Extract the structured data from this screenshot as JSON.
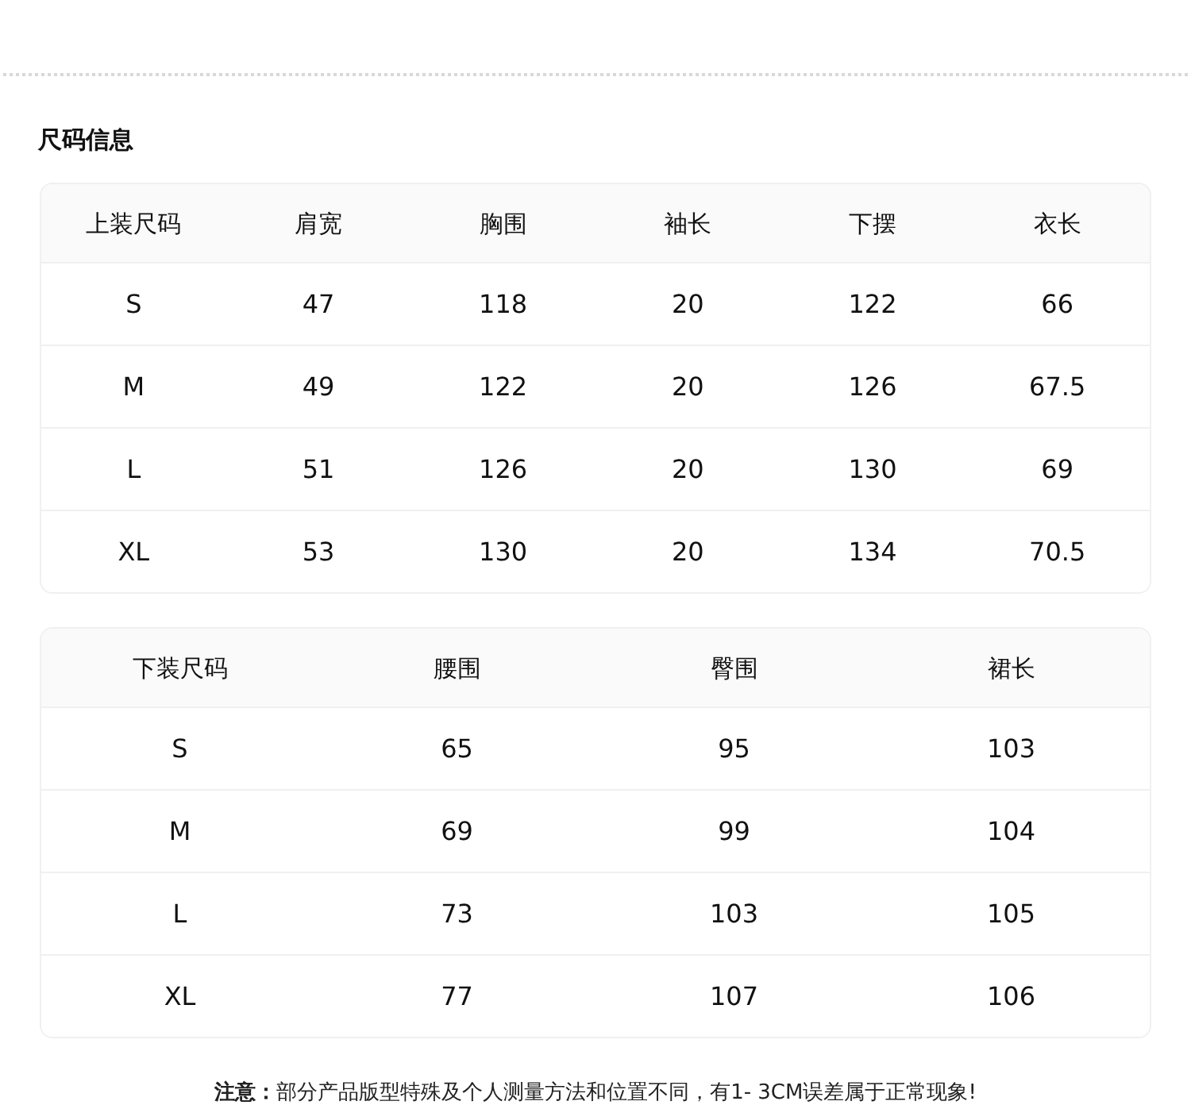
{
  "title": "尺码信息",
  "tables": [
    {
      "columns": [
        "上装尺码",
        "肩宽",
        "胸围",
        "袖长",
        "下摆",
        "衣长"
      ],
      "rows": [
        [
          "S",
          "47",
          "118",
          "20",
          "122",
          "66"
        ],
        [
          "M",
          "49",
          "122",
          "20",
          "126",
          "67.5"
        ],
        [
          "L",
          "51",
          "126",
          "20",
          "130",
          "69"
        ],
        [
          "XL",
          "53",
          "130",
          "20",
          "134",
          "70.5"
        ]
      ]
    },
    {
      "columns": [
        "下装尺码",
        "腰围",
        "臀围",
        "裙长"
      ],
      "rows": [
        [
          "S",
          "65",
          "95",
          "103"
        ],
        [
          "M",
          "69",
          "99",
          "104"
        ],
        [
          "L",
          "73",
          "103",
          "105"
        ],
        [
          "XL",
          "77",
          "107",
          "106"
        ]
      ]
    }
  ],
  "note": "**注意：**部分产品版型特殊及个人测量方法和位置不同，有1- 3CM误差属于正常现象!"
}
